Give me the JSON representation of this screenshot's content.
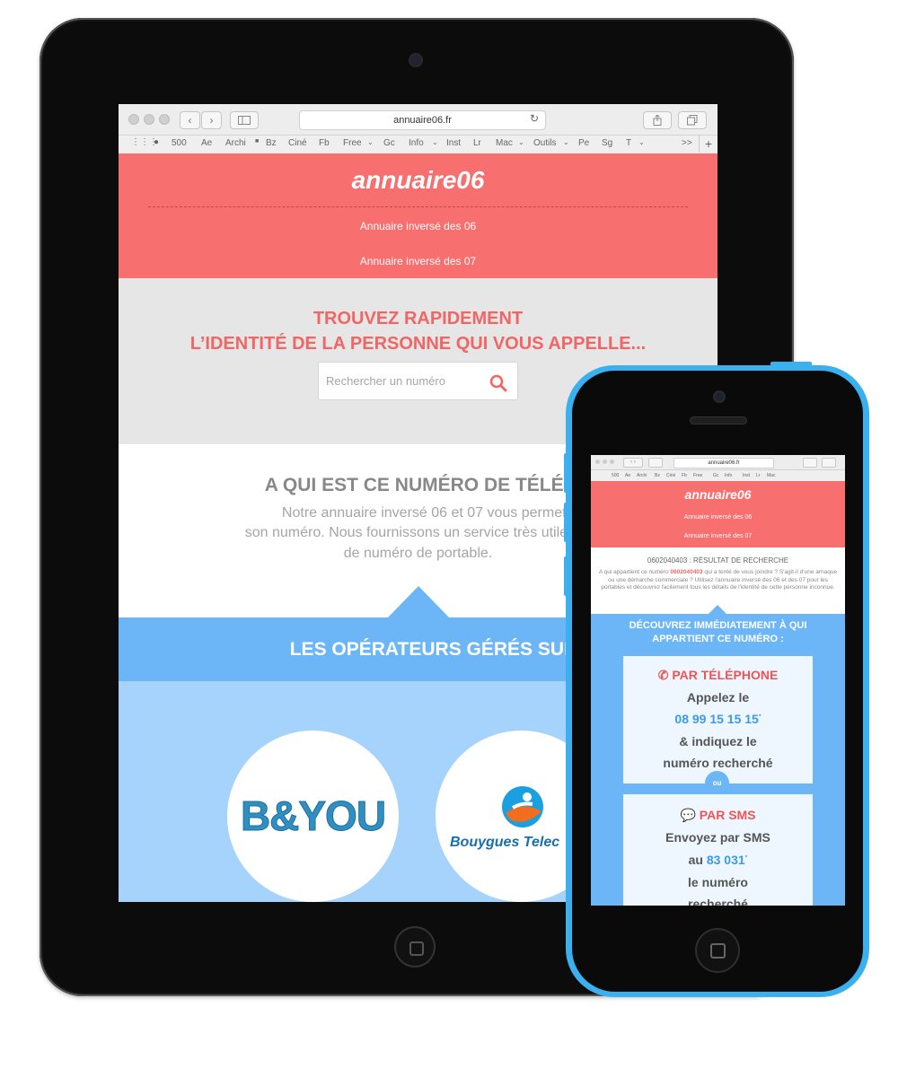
{
  "tablet": {
    "browser": {
      "url": "annuaire06.fr",
      "bookmarks": [
        "500",
        "Ae",
        "Archi",
        "Bz",
        "Ciné",
        "Fb",
        "Free",
        "Gc",
        "Info",
        "Inst",
        "Lr",
        "Mac",
        "Outils",
        "Pe",
        "Sg",
        "T"
      ],
      "overflow": ">>",
      "add_tab": "+"
    },
    "site": {
      "logo": "annuaire06",
      "nav": [
        "Annuaire inversé des 06",
        "Annuaire inversé des 07"
      ],
      "hero_line1": "TROUVEZ RAPIDEMENT",
      "hero_line2": "L’IDENTITÉ DE LA PERSONNE QUI VOUS APPELLE...",
      "search_placeholder": "Rechercher un numéro",
      "info_title": "A QUI EST CE NUMÉRO DE TÉLÉPHONE",
      "info_p1": "Notre annuaire inversé 06 et 07 vous permet d’identifier la pe",
      "info_p2": "son numéro. Nous fournissons un service très utile appelé re",
      "info_p3": "de numéro de portable.",
      "operators_title": "LES OPÉRATEURS GÉRÉS SUR CE",
      "operators": [
        "B&YOU",
        "Bouygues Telec"
      ]
    }
  },
  "phone": {
    "browser": {
      "url": "annuaire06.fr",
      "bookmarks": [
        "500",
        "Ae",
        "Archi",
        "Bz",
        "Ciné",
        "Fb",
        "Free",
        "Gc",
        "Info",
        "Inst",
        "Lr",
        "Mac"
      ]
    },
    "site": {
      "logo": "annuaire06",
      "nav": [
        "Annuaire inversé des 06",
        "Annuaire inversé des 07"
      ],
      "result_title": "0602040403 : RÉSULTAT DE RECHERCHE",
      "desc_before": "A qui appartient ce numéro ",
      "desc_number": "0602040403",
      "desc_after": " qui a tenté de vous joindre ? S'agit-il d'une arnaque ou une démarche commerciale ? Utilisez l'annuaire inversé des 06 et des 07 pour les portables et découvrez facilement tous les détails de l'identité de cette personne inconnue.",
      "discover_line1": "DÉCOUVREZ IMMÉDIATEMENT À QUI",
      "discover_line2": "APPARTIENT CE NUMÉRO :",
      "phone_card": {
        "title": "PAR TÉLÉPHONE",
        "line1": "Appelez le",
        "number": "08 99 15 15 15",
        "asterisk": "*",
        "line2": "& indiquez le",
        "line3": "numéro recherché"
      },
      "separator": "ou",
      "sms_card": {
        "title": "PAR SMS",
        "line1": "Envoyez par SMS",
        "prefix": "au",
        "number": "83 031",
        "asterisk": "*",
        "line2": "le numéro",
        "line3": "recherché"
      }
    }
  }
}
